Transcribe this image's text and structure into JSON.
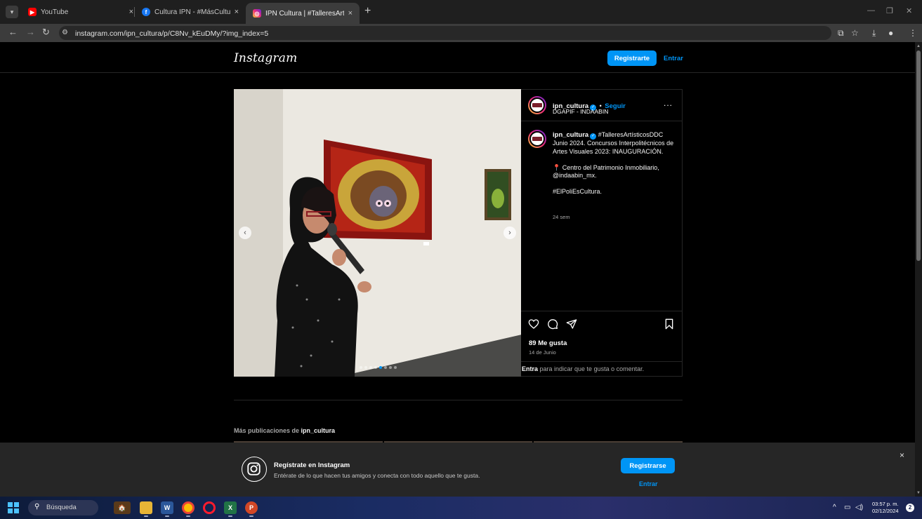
{
  "browser": {
    "tabs": [
      {
        "title": "YouTube",
        "close": "×"
      },
      {
        "title": "Cultura IPN - #MásCulturalIPN",
        "close": "×"
      },
      {
        "title": "IPN Cultura | #TalleresArtísticos",
        "close": "×"
      }
    ],
    "new_tab": "+",
    "url": "instagram.com/ipn_cultura/p/C8Nv_kEuDMy/?img_index=5"
  },
  "instagram": {
    "logo": "Instagram",
    "register_label": "Registrarte",
    "login_label": "Entrar",
    "post": {
      "username": "ipn_cultura",
      "separator": "•",
      "follow_label": "Seguir",
      "subtitle": "DGAPIF - INDAABIN",
      "more": "...",
      "caption_lines": [
        "#TalleresArtísticosDDC Junio 2024. Concursos Interpolitécnicos de Artes Visuales 2023: INAUGURACIÓN.",
        "📍 Centro del Patrimonio Inmobiliario, @indaabin_mx.",
        "#ElPoliEsCultura."
      ],
      "time_ago": "24 sem",
      "likes": "89 Me gusta",
      "date": "14 de Junio",
      "login_hint_link": "Entra",
      "login_hint_text": " para indicar que te gusta o comentar.",
      "carousel_count": 8,
      "carousel_active": 5
    },
    "more_posts_prefix": "Más publicaciones de ",
    "more_posts_user": "ipn_cultura",
    "banner": {
      "title": "Regístrate en Instagram",
      "subtitle": "Entérate de lo que hacen tus amigos y conecta con todo aquello que te gusta.",
      "signup_label": "Registrarse",
      "login_label": "Entrar",
      "close": "×"
    }
  },
  "taskbar": {
    "search_placeholder": "Búsqueda",
    "time": "03:57 p. m.",
    "date": "02/12/2024",
    "notification_count": "2"
  },
  "colors": {
    "instagram_blue": "#0095f6",
    "page_background": "#000000",
    "taskbar": "#1a2c63"
  }
}
